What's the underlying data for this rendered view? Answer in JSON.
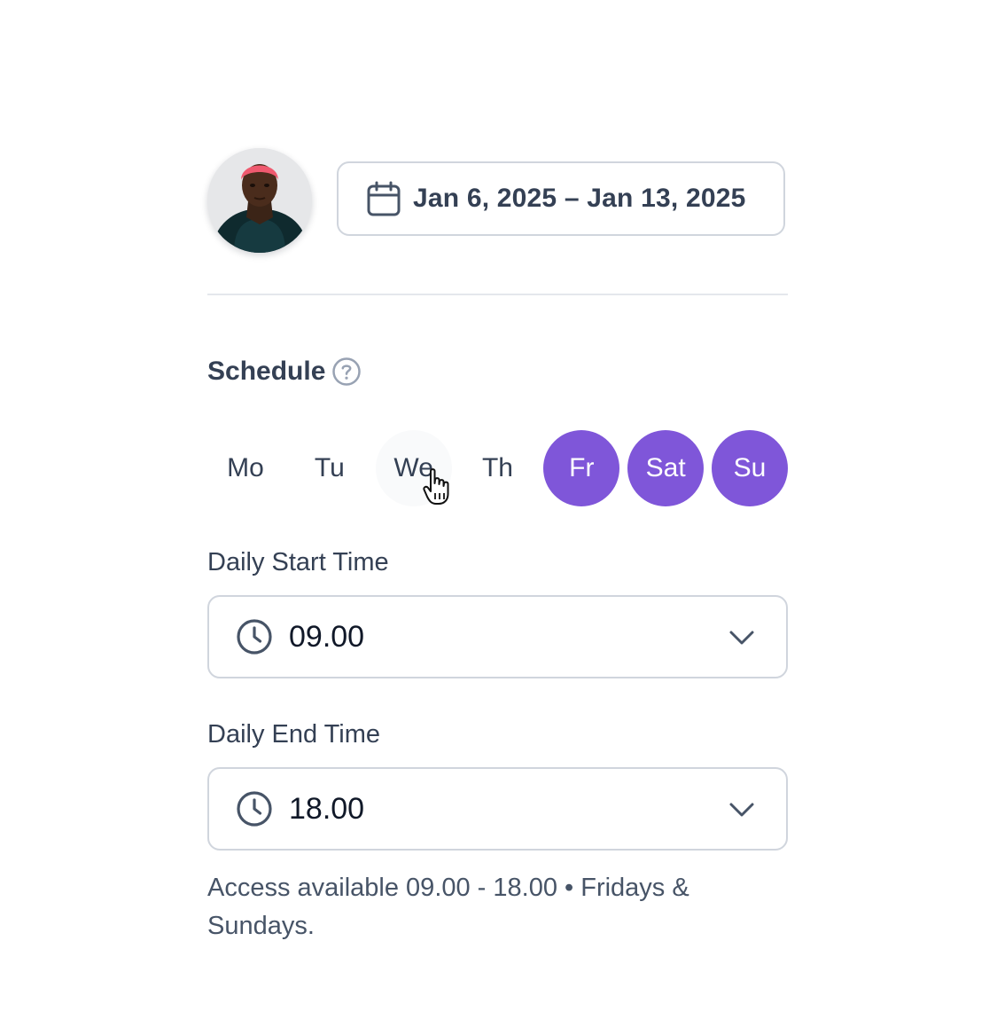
{
  "date_range": {
    "label": "Jan 6, 2025 – Jan 13, 2025",
    "icon": "calendar-icon"
  },
  "schedule": {
    "title": "Schedule",
    "help_icon": "help-circle-icon",
    "days": [
      {
        "label": "Mo",
        "selected": false
      },
      {
        "label": "Tu",
        "selected": false
      },
      {
        "label": "We",
        "selected": false
      },
      {
        "label": "Th",
        "selected": false
      },
      {
        "label": "Fr",
        "selected": true
      },
      {
        "label": "Sat",
        "selected": true
      },
      {
        "label": "Su",
        "selected": true
      }
    ]
  },
  "start_time": {
    "label": "Daily Start Time",
    "value": "09.00",
    "icon": "clock-icon"
  },
  "end_time": {
    "label": "Daily End Time",
    "value": "18.00",
    "icon": "clock-icon"
  },
  "note": "Access available 09.00 - 18.00 • Fridays & Sundays.",
  "colors": {
    "accent": "#7f56d9",
    "border": "#d0d5dd",
    "text": "#344054"
  }
}
